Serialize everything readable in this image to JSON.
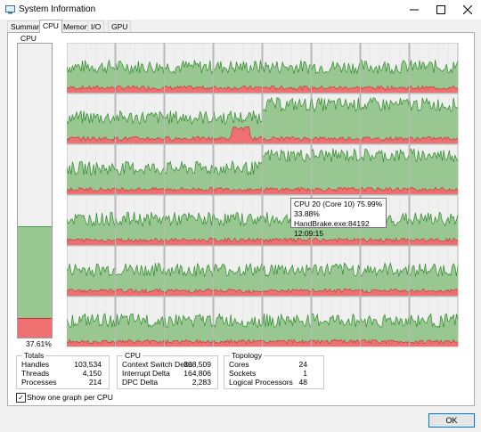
{
  "window": {
    "title": "System Information",
    "minimize_label": "—",
    "maximize_label": "☐",
    "close_label": "✕"
  },
  "tabs": [
    {
      "label": "Summary"
    },
    {
      "label": "CPU"
    },
    {
      "label": "Memory"
    },
    {
      "label": "I/O"
    },
    {
      "label": "GPU"
    }
  ],
  "cpu": {
    "label": "CPU",
    "usage_text": "37.61%",
    "usage_percent": 37.61,
    "kernel_percent": 6.4
  },
  "colors": {
    "user": "#98c792",
    "user_line": "#2f8a2b",
    "kernel": "#ef7070",
    "kernel_line": "#c42e2e",
    "graph_bg": "#f0f0f0",
    "grid": "#e2e2e2"
  },
  "grid": {
    "rows": 6,
    "cols": 8
  },
  "tooltip": {
    "line1": "CPU 20 (Core 10) 75.99%",
    "line2": "33.88% HandBrake.exe:84192",
    "line3": "12:09:15"
  },
  "totals": {
    "title": "Totals",
    "rows": [
      {
        "label": "Handles",
        "value": "103,534"
      },
      {
        "label": "Threads",
        "value": "4,150"
      },
      {
        "label": "Processes",
        "value": "214"
      }
    ]
  },
  "cpu_stats": {
    "title": "CPU",
    "rows": [
      {
        "label": "Context Switch Delta",
        "value": "308,509"
      },
      {
        "label": "Interrupt Delta",
        "value": "164,806"
      },
      {
        "label": "DPC Delta",
        "value": "2,283"
      }
    ]
  },
  "topology": {
    "title": "Topology",
    "rows": [
      {
        "label": "Cores",
        "value": "24"
      },
      {
        "label": "Sockets",
        "value": "1"
      },
      {
        "label": "Logical Processors",
        "value": "48"
      }
    ]
  },
  "options": {
    "show_one_graph_label": "Show one graph per CPU",
    "show_one_graph_checked": true,
    "check_mark": "✓"
  },
  "ok_label": "OK"
}
